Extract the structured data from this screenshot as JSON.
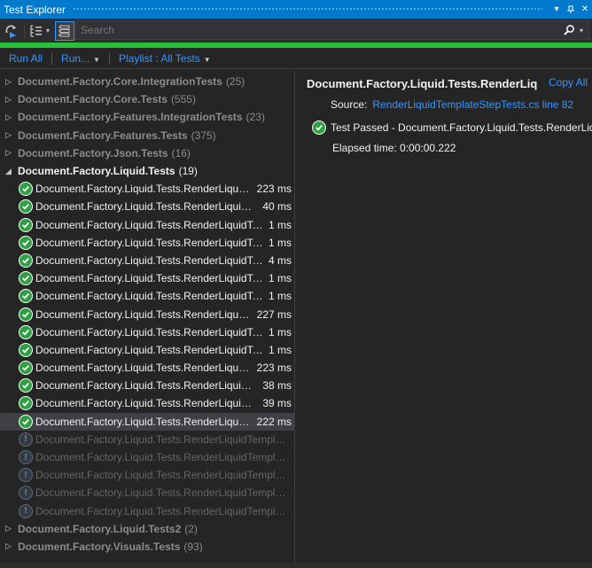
{
  "window": {
    "title": "Test Explorer",
    "menu_glyph": "▾",
    "pin_glyph": "pin",
    "close_glyph": "✕"
  },
  "toolbar": {
    "search_placeholder": "Search",
    "dropdown_glyph": "▾"
  },
  "progress": {
    "fraction": 1.0,
    "color": "#27c137"
  },
  "commands": {
    "run_all": "Run All",
    "run": "Run...",
    "playlist": "Playlist : All Tests",
    "caret": "▼"
  },
  "tree": {
    "groups_before": [
      {
        "name": "Document.Factory.Core.IntegrationTests",
        "count": "(25)",
        "arrow": "▷"
      },
      {
        "name": "Document.Factory.Core.Tests",
        "count": "(555)",
        "arrow": "▷"
      },
      {
        "name": "Document.Factory.Features.IntegrationTests",
        "count": "(23)",
        "arrow": "▷"
      },
      {
        "name": "Document.Factory.Features.Tests",
        "count": "(375)",
        "arrow": "▷"
      },
      {
        "name": "Document.Factory.Json.Tests",
        "count": "(16)",
        "arrow": "▷"
      }
    ],
    "expanded_group": {
      "name": "Document.Factory.Liquid.Tests",
      "count": "(19)",
      "arrow": "◢"
    },
    "tests": [
      {
        "name": "Document.Factory.Liquid.Tests.RenderLiquidT...",
        "duration": "223 ms",
        "status": "passed"
      },
      {
        "name": "Document.Factory.Liquid.Tests.RenderLiquidTe...",
        "duration": "40 ms",
        "status": "passed"
      },
      {
        "name": "Document.Factory.Liquid.Tests.RenderLiquidTes...",
        "duration": "1 ms",
        "status": "passed"
      },
      {
        "name": "Document.Factory.Liquid.Tests.RenderLiquidTes...",
        "duration": "1 ms",
        "status": "passed"
      },
      {
        "name": "Document.Factory.Liquid.Tests.RenderLiquidTe...",
        "duration": "4 ms",
        "status": "passed"
      },
      {
        "name": "Document.Factory.Liquid.Tests.RenderLiquidTes...",
        "duration": "1 ms",
        "status": "passed"
      },
      {
        "name": "Document.Factory.Liquid.Tests.RenderLiquidTes...",
        "duration": "1 ms",
        "status": "passed"
      },
      {
        "name": "Document.Factory.Liquid.Tests.RenderLiquidT...",
        "duration": "227 ms",
        "status": "passed"
      },
      {
        "name": "Document.Factory.Liquid.Tests.RenderLiquidTes...",
        "duration": "1 ms",
        "status": "passed"
      },
      {
        "name": "Document.Factory.Liquid.Tests.RenderLiquidTes...",
        "duration": "1 ms",
        "status": "passed"
      },
      {
        "name": "Document.Factory.Liquid.Tests.RenderLiquidT...",
        "duration": "223 ms",
        "status": "passed"
      },
      {
        "name": "Document.Factory.Liquid.Tests.RenderLiquidTe...",
        "duration": "38 ms",
        "status": "passed"
      },
      {
        "name": "Document.Factory.Liquid.Tests.RenderLiquidTe...",
        "duration": "39 ms",
        "status": "passed"
      },
      {
        "name": "Document.Factory.Liquid.Tests.RenderLiquidT...",
        "duration": "222 ms",
        "status": "passed",
        "selected": true
      },
      {
        "name": "Document.Factory.Liquid.Tests.RenderLiquidTemplat...",
        "duration": "",
        "status": "notrun"
      },
      {
        "name": "Document.Factory.Liquid.Tests.RenderLiquidTemplat...",
        "duration": "",
        "status": "notrun"
      },
      {
        "name": "Document.Factory.Liquid.Tests.RenderLiquidTemplat...",
        "duration": "",
        "status": "notrun"
      },
      {
        "name": "Document.Factory.Liquid.Tests.RenderLiquidTemplat...",
        "duration": "",
        "status": "notrun"
      },
      {
        "name": "Document.Factory.Liquid.Tests.RenderLiquidTemplat...",
        "duration": "",
        "status": "notrun"
      }
    ],
    "groups_after": [
      {
        "name": "Document.Factory.Liquid.Tests2",
        "count": "(2)",
        "arrow": "▷"
      },
      {
        "name": "Document.Factory.Visuals.Tests",
        "count": "(93)",
        "arrow": "▷"
      }
    ]
  },
  "detail": {
    "title": "Document.Factory.Liquid.Tests.RenderLiq",
    "copy_all": "Copy All",
    "source_label": "Source:",
    "source_link": "RenderLiquidTemplateStepTests.cs line 82",
    "result": "Test Passed - Document.Factory.Liquid.Tests.RenderLiq",
    "elapsed": "Elapsed time: 0:00:00.222"
  },
  "colors": {
    "accent": "#007acc",
    "link": "#3794ff",
    "passed": "#2ea043",
    "background": "#252526"
  }
}
